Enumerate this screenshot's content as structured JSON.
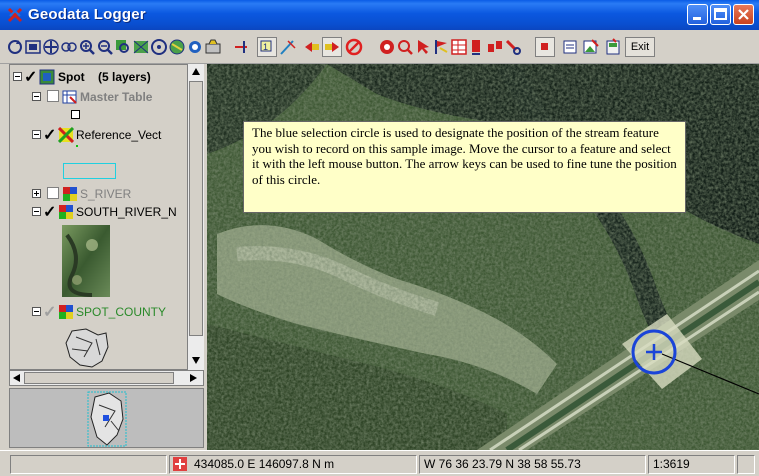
{
  "window": {
    "title": "Geodata Logger"
  },
  "toolbar": {
    "exit_label": "Exit"
  },
  "layers": {
    "group_label": "Spot",
    "group_count": "(5 layers)",
    "items": [
      {
        "label": "Master Table"
      },
      {
        "label": "Reference_Vect"
      },
      {
        "label": "S_RIVER"
      },
      {
        "label": "SOUTH_RIVER_N"
      },
      {
        "label": "SPOT_COUNTY"
      }
    ]
  },
  "map": {
    "tooltip": "The blue selection circle is used to designate the position of the stream feature you wish to record on this sample image.  Move the cursor to a feature and select it with the left mouse button.  The arrow keys can be used to fine tune the position of this circle."
  },
  "status": {
    "utm": "434085.0 E  146097.8 N m",
    "latlon": "W 76 36 23.79  N 38 58 55.73",
    "scale": "1:3619"
  },
  "colors": {
    "titlebar": "#0b58e0",
    "selection_circle": "#1a44d8",
    "tooltip_bg": "#ffffc8",
    "layer_disabled_text": "#808080",
    "spot_county_text": "#2a8a2a"
  }
}
